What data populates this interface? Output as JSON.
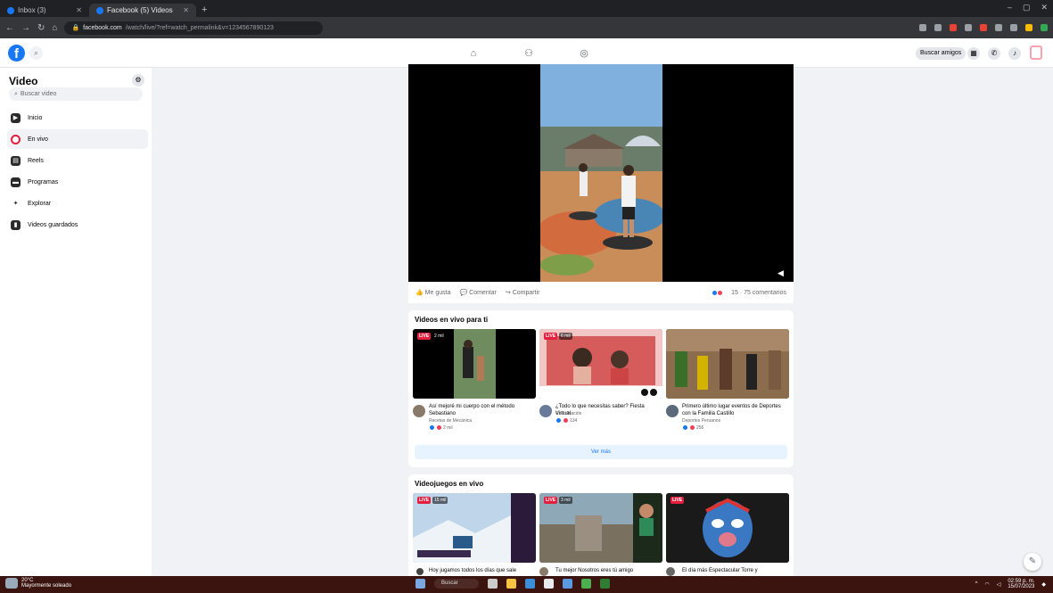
{
  "browser": {
    "tabs": [
      {
        "label": "Inbox (3)",
        "active": false
      },
      {
        "label": "Facebook (5) Videos",
        "active": true
      }
    ],
    "new_tab_icon": "plus-icon",
    "url_domain": "facebook.com",
    "url_path": "/watch/live/?ref=watch_permalink&v=1234567890123"
  },
  "fb_header": {
    "logo": "f",
    "nav_icons": [
      "home-icon",
      "friends-icon",
      "groups-icon"
    ],
    "find_friends": "Buscar amigos"
  },
  "sidebar": {
    "title": "Video",
    "search_placeholder": "Buscar video",
    "items": [
      {
        "label": "Inicio",
        "icon": "video-home-icon"
      },
      {
        "label": "En vivo",
        "icon": "live-icon",
        "selected": true
      },
      {
        "label": "Reels",
        "icon": "reels-icon"
      },
      {
        "label": "Programas",
        "icon": "shows-icon"
      },
      {
        "label": "Explorar",
        "icon": "explore-icon"
      },
      {
        "label": "Videos guardados",
        "icon": "saved-icon"
      }
    ]
  },
  "post": {
    "actions": {
      "like": "Me gusta",
      "comment": "Comentar",
      "share": "Compartir"
    },
    "reactions": "15 · 75 comentarios"
  },
  "live_for_you": {
    "title": "Videos en vivo para ti",
    "videos": [
      {
        "title": "Así mejoré mi cuerpo con el método Sebastiano",
        "channel": "Recetas de Mecánica",
        "reactions": "2 mil",
        "viewers": "2 mil"
      },
      {
        "title": "¿Todo lo que necesitas saber? Fiesta Virtual",
        "channel": "Coordinación",
        "reactions": "134",
        "viewers": "6 mil"
      },
      {
        "title": "Primero último lugar eventos de Deportes con la Familia Castillo",
        "channel": "Deportes Peruanos",
        "reactions": "256",
        "viewers": ""
      }
    ],
    "see_more": "Ver más"
  },
  "live_games": {
    "title": "Videojuegos en vivo",
    "videos": [
      {
        "title": "Hoy jugamos todos los días que sale",
        "viewers": "15 mil"
      },
      {
        "title": "Tu mejor Nosotros eres tú amigo",
        "viewers": "3 mil"
      },
      {
        "title": "El día más Espectacular Torre y",
        "viewers": ""
      }
    ]
  },
  "taskbar": {
    "weather_temp": "20°C",
    "weather_desc": "Mayormente soleado",
    "search": "Buscar",
    "time": "02:59 p. m.",
    "date": "15/07/2023"
  }
}
